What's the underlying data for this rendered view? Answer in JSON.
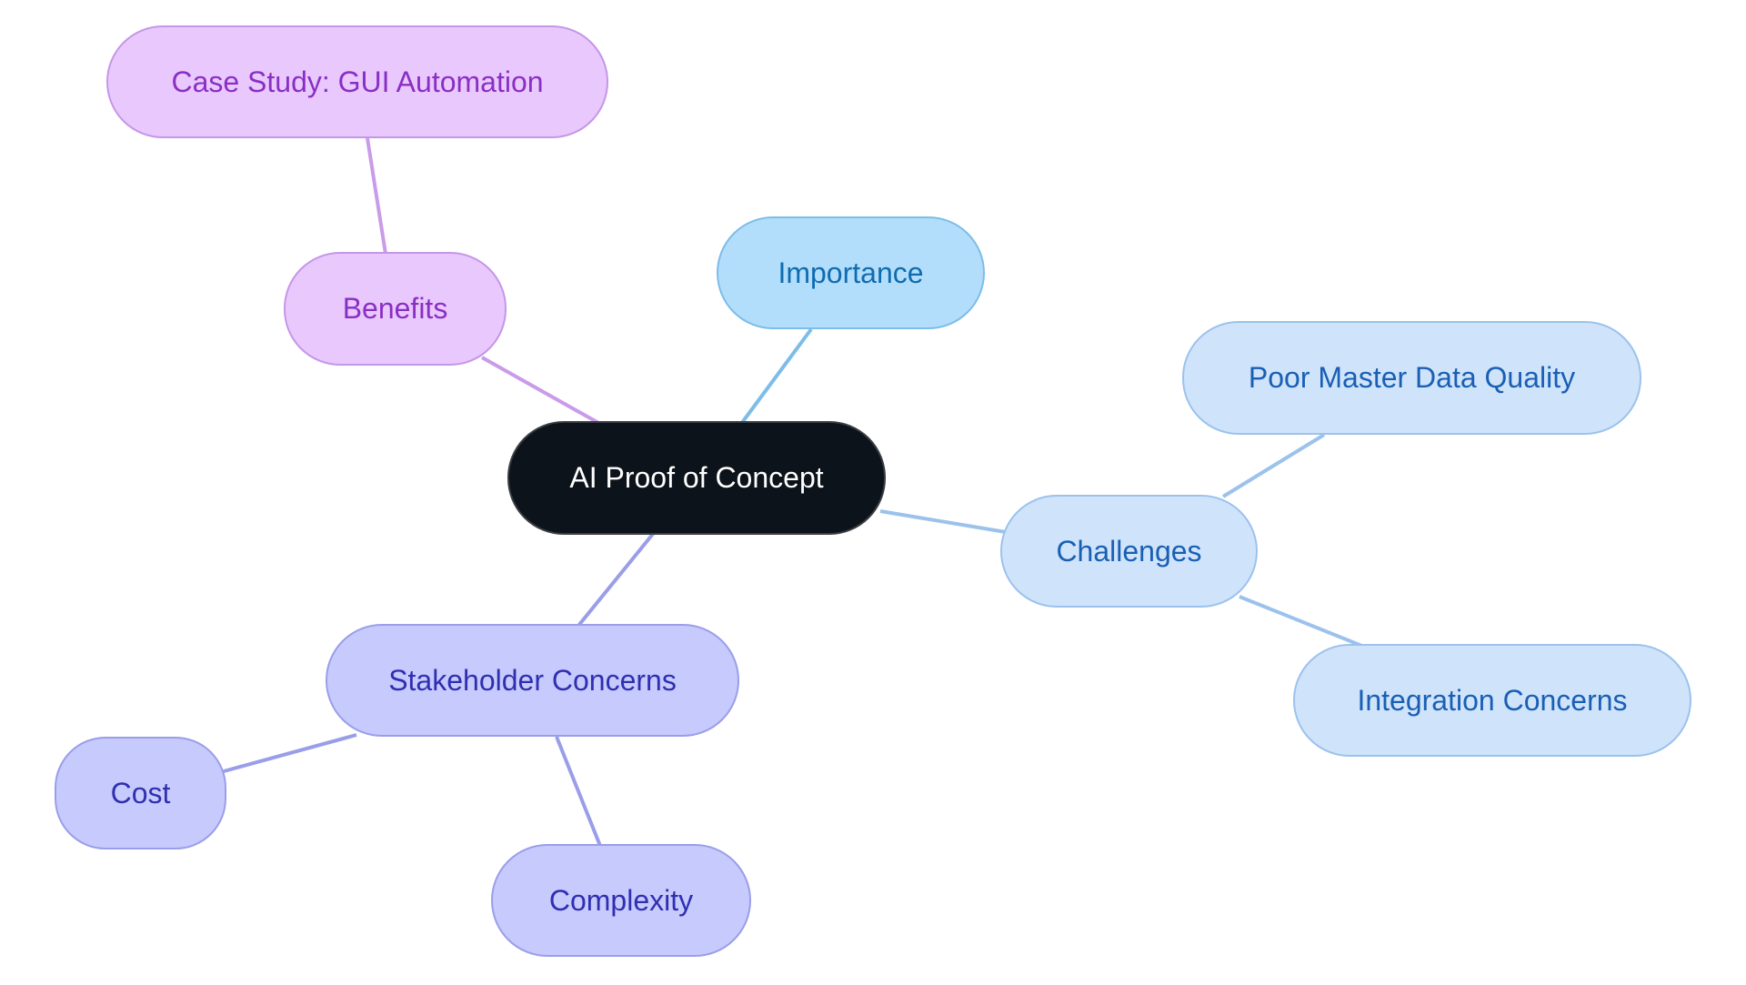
{
  "diagram": {
    "type": "mind-map",
    "root": {
      "id": "root",
      "label": "AI Proof of Concept"
    },
    "nodes": [
      {
        "id": "root",
        "label": "AI Proof of Concept",
        "parent": null,
        "theme": "root"
      },
      {
        "id": "benefits",
        "label": "Benefits",
        "parent": "root",
        "theme": "purple"
      },
      {
        "id": "case-study",
        "label": "Case Study: GUI Automation",
        "parent": "benefits",
        "theme": "purple"
      },
      {
        "id": "importance",
        "label": "Importance",
        "parent": "root",
        "theme": "sky"
      },
      {
        "id": "challenges",
        "label": "Challenges",
        "parent": "root",
        "theme": "blue"
      },
      {
        "id": "poor-master-data",
        "label": "Poor Master Data Quality",
        "parent": "challenges",
        "theme": "blue"
      },
      {
        "id": "integration",
        "label": "Integration Concerns",
        "parent": "challenges",
        "theme": "blue"
      },
      {
        "id": "stakeholder",
        "label": "Stakeholder Concerns",
        "parent": "root",
        "theme": "indigo"
      },
      {
        "id": "cost",
        "label": "Cost",
        "parent": "stakeholder",
        "theme": "indigo"
      },
      {
        "id": "complexity",
        "label": "Complexity",
        "parent": "stakeholder",
        "theme": "indigo"
      }
    ],
    "colors": {
      "root_fill": "#0d131a",
      "purple_edge": "#c99be9",
      "sky_edge": "#7cbde9",
      "blue_edge": "#9cc2ec",
      "indigo_edge": "#9a9ee9"
    }
  }
}
